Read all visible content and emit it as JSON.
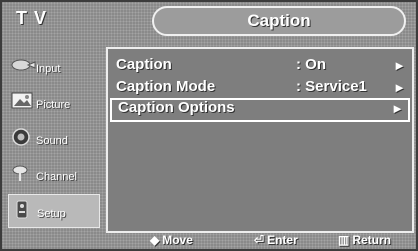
{
  "header": {
    "app_title": "TV",
    "menu_title": "Caption"
  },
  "sidebar": {
    "items": [
      {
        "label": "Input",
        "icon": "input-icon"
      },
      {
        "label": "Picture",
        "icon": "picture-icon"
      },
      {
        "label": "Sound",
        "icon": "sound-icon"
      },
      {
        "label": "Channel",
        "icon": "channel-icon"
      },
      {
        "label": "Setup",
        "icon": "setup-icon"
      }
    ],
    "active_index": 4
  },
  "menu": {
    "rows": [
      {
        "label": "Caption",
        "value": ": On",
        "arrow": "►"
      },
      {
        "label": "Caption Mode",
        "value": ": Service1",
        "arrow": "►"
      },
      {
        "label": "Caption Options",
        "value": "",
        "arrow": "►"
      }
    ],
    "selected_index": 2
  },
  "footer": {
    "move": {
      "icon": "◆",
      "label": "Move"
    },
    "enter": {
      "icon": "⏎",
      "label": "Enter"
    },
    "return": {
      "icon": "▥",
      "label": "Return"
    }
  },
  "colors": {
    "background": "#8a8a8a",
    "panel": "#7e7e7e",
    "text": "#ffffff",
    "selection_border": "#ffffff"
  }
}
